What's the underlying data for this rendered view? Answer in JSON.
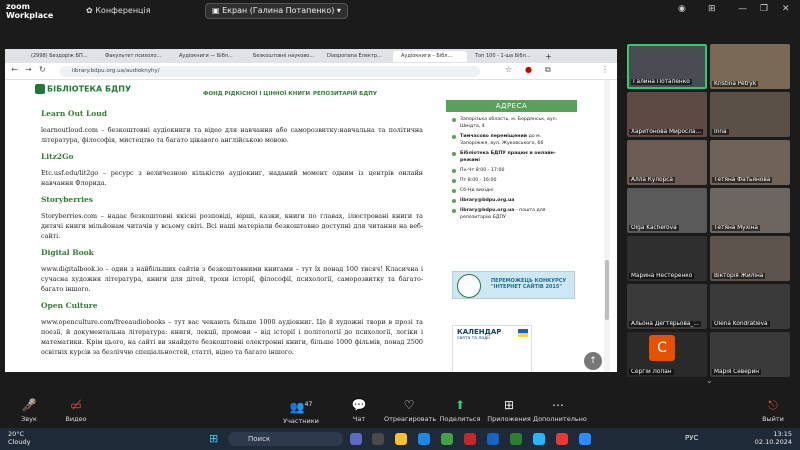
{
  "zoom": {
    "logo_line1": "zoom",
    "logo_line2": "Workplace",
    "conference": "Конференція",
    "screen_share": "Екран (Галина Потапенко)"
  },
  "browser": {
    "tabs": [
      "(2998) Бездоріж БП...",
      "Факультет психоло...",
      "Аудіокниги — Бібл...",
      "Безкоштовні науково...",
      "Diasporiana Електр...",
      "Аудіокниги – Бібл...",
      "Топ 100 - 1-ша Бібл..."
    ],
    "url": "library.bdpu.org.ua/audioknyhy/"
  },
  "site": {
    "logo": "БІБЛІОТЕКА БДПУ",
    "nav": [
      "ФОНД РІДКІСНОЇ І ЦІННОЇ КНИГИ",
      "РЕПОЗИТАРІЙ БДПУ"
    ]
  },
  "article": [
    {
      "title": "Learn Out Loud",
      "text": "learnoutloud.com – безкоштовні аудіокниги та відео для навчання або саморозвитку:навчальна та політична література, філософія, мистецтво та багато цікавого англійською мовою."
    },
    {
      "title": "Litz2Go",
      "text": "Etc.usf.edu/lit2go – ресурс з величезною кількістю аудіокниг, наданий момент одним із центрів онлайн навчання Флорида."
    },
    {
      "title": "Storyberries",
      "text": "Storyberries.com – надає безкоштовні якісні розповіді, вірші, казки, книги по главах, ілюстровані книги та дитячі книги мільйонам читачів у всьому світі. Всі наші матеріали безкоштовно доступні для читання на веб-сайті."
    },
    {
      "title": "Digital Book",
      "text": "www.digitalbook.io – один з найбільших сайтів з безкоштовними книгами – тут їх понад 100 тисяч! Класична і сучасна художня література, книги для дітей, трохи історії, філософії, психології, саморозвитку та багато-багато іншого."
    },
    {
      "title": "Open Culture",
      "text": "www.openculture.com/freeaudiobooks – тут вас чекають більше 1000 аудіокниг. Це й художні твори в прозі та поезії, й документальна література: книги, лекції, промови – від історії і політології до психології, логіки і математики. Крім цього, на сайті ви знайдете безкоштовні електронні книги, більше 1000 фільмів, понад 2500 освітніх курсів за безліччю спеціальностей, статті, відео та багато іншого."
    }
  ],
  "sidebar": {
    "heading": "АДРЕСА",
    "address": "Запорізька область, м. Бердянськ, вул. Шмідта, 4",
    "moved_label": "Тимчасово переміщений",
    "moved_text": "до м. Запоріжжя, вул. Жуковського, 66",
    "online": "Бібліотека БДПУ працює в онлайн-режимі",
    "hours1": "Пн-Чт 8:00 - 17:00",
    "hours2": "Пт 8:00 - 16:00",
    "hours3": "Сб-Нд вихідні",
    "email1": "library@bdpu.org.ua",
    "email2": "library@bdpu.org.ua",
    "email2_note": "- пошта для репозитарію БДПУ",
    "contest_line1": "ПЕРЕМОЖЕЦЬ КОНКУРСУ",
    "contest_line2": "\"ІНТЕРНЕТ САЙТІВ 2015\"",
    "calendar_title": "КАЛЕНДАР",
    "calendar_sub": "свята та події"
  },
  "participants": [
    {
      "name": "Галина Потапенко",
      "speaking": true
    },
    {
      "name": "Kristina Petryk",
      "speaking": false
    },
    {
      "name": "Харитонова Миросла...",
      "speaking": false
    },
    {
      "name": "Inna",
      "speaking": false
    },
    {
      "name": "Алла Кулорса",
      "speaking": false
    },
    {
      "name": "Тетяна Фатьянова",
      "speaking": false
    },
    {
      "name": "Olga Kacherova",
      "speaking": false
    },
    {
      "name": "Тетяна Мухіна",
      "speaking": false
    },
    {
      "name": "Марина Нестеренко",
      "speaking": false
    },
    {
      "name": "Вікторія Жиліна",
      "speaking": false
    },
    {
      "name": "Альона Дегтярьова_...",
      "speaking": false
    },
    {
      "name": "Olena Kondratieva",
      "speaking": false
    },
    {
      "name": "Сергій Лопан",
      "speaking": false
    },
    {
      "name": "Марія Северин",
      "speaking": false
    }
  ],
  "toolbar": {
    "mute": "Звук",
    "video": "Видео",
    "participants": "Участники",
    "participants_count": "47",
    "chat": "Чат",
    "react": "Отреагировать",
    "share": "Поделиться",
    "apps": "Приложения",
    "more": "Дополнительно",
    "leave": "Выйти"
  },
  "taskbar": {
    "temp": "20°C",
    "weather": "Cloudy",
    "search": "Поиск",
    "lang": "РУС",
    "time": "13:15",
    "date": "02.10.2024"
  },
  "colors": {
    "accent_green": "#2e7d32",
    "zoom_green": "#2ecc71",
    "leave_red": "#e74c3c"
  }
}
